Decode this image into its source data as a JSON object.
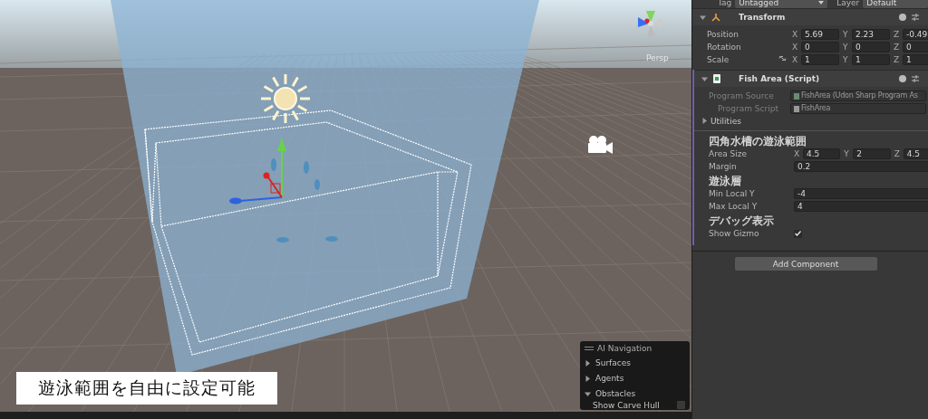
{
  "scene": {
    "view_label": "Persp",
    "overlay": {
      "title": "AI Navigation",
      "sections": [
        {
          "label": "Surfaces",
          "expanded": false
        },
        {
          "label": "Agents",
          "expanded": false
        },
        {
          "label": "Obstacles",
          "expanded": true
        }
      ],
      "option": {
        "label": "Show Carve Hull",
        "checked": false
      }
    },
    "caption": "遊泳範囲を自由に設定可能"
  },
  "inspector": {
    "tag": {
      "label": "Tag",
      "value": "Untagged"
    },
    "layer": {
      "label": "Layer",
      "value": "Default"
    },
    "transform": {
      "title": "Transform",
      "expanded": true,
      "rows": [
        {
          "label": "Position",
          "linked": false,
          "values": [
            {
              "axis": "X",
              "value": "5.69"
            },
            {
              "axis": "Y",
              "value": "2.23"
            },
            {
              "axis": "Z",
              "value": "-0.49"
            }
          ]
        },
        {
          "label": "Rotation",
          "linked": false,
          "values": [
            {
              "axis": "X",
              "value": "0"
            },
            {
              "axis": "Y",
              "value": "0"
            },
            {
              "axis": "Z",
              "value": "0"
            }
          ]
        },
        {
          "label": "Scale",
          "linked": true,
          "values": [
            {
              "axis": "X",
              "value": "1"
            },
            {
              "axis": "Y",
              "value": "1"
            },
            {
              "axis": "Z",
              "value": "1"
            }
          ]
        }
      ]
    },
    "script": {
      "title": "Fish Area (Script)",
      "expanded": true,
      "program_source": {
        "label": "Program Source",
        "value": "FishArea (Udon Sharp Program As"
      },
      "program_script": {
        "label": "Program Script",
        "value": "FishArea"
      },
      "utilities": {
        "label": "Utilities",
        "expanded": false
      },
      "groups": [
        {
          "header": "四角水槽の遊泳範囲",
          "rows": [
            {
              "kind": "vector",
              "label": "Area Size",
              "values": [
                {
                  "axis": "X",
                  "value": "4.5"
                },
                {
                  "axis": "Y",
                  "value": "2"
                },
                {
                  "axis": "Z",
                  "value": "4.5"
                }
              ]
            },
            {
              "kind": "number",
              "label": "Margin",
              "value": "0.2"
            }
          ]
        },
        {
          "header": "遊泳層",
          "rows": [
            {
              "kind": "number",
              "label": "Min Local Y",
              "value": "-4"
            },
            {
              "kind": "number",
              "label": "Max Local Y",
              "value": "4"
            }
          ]
        },
        {
          "header": "デバッグ表示",
          "rows": [
            {
              "kind": "toggle",
              "label": "Show Gizmo",
              "checked": true
            }
          ]
        }
      ]
    },
    "add_button": "Add Component"
  }
}
